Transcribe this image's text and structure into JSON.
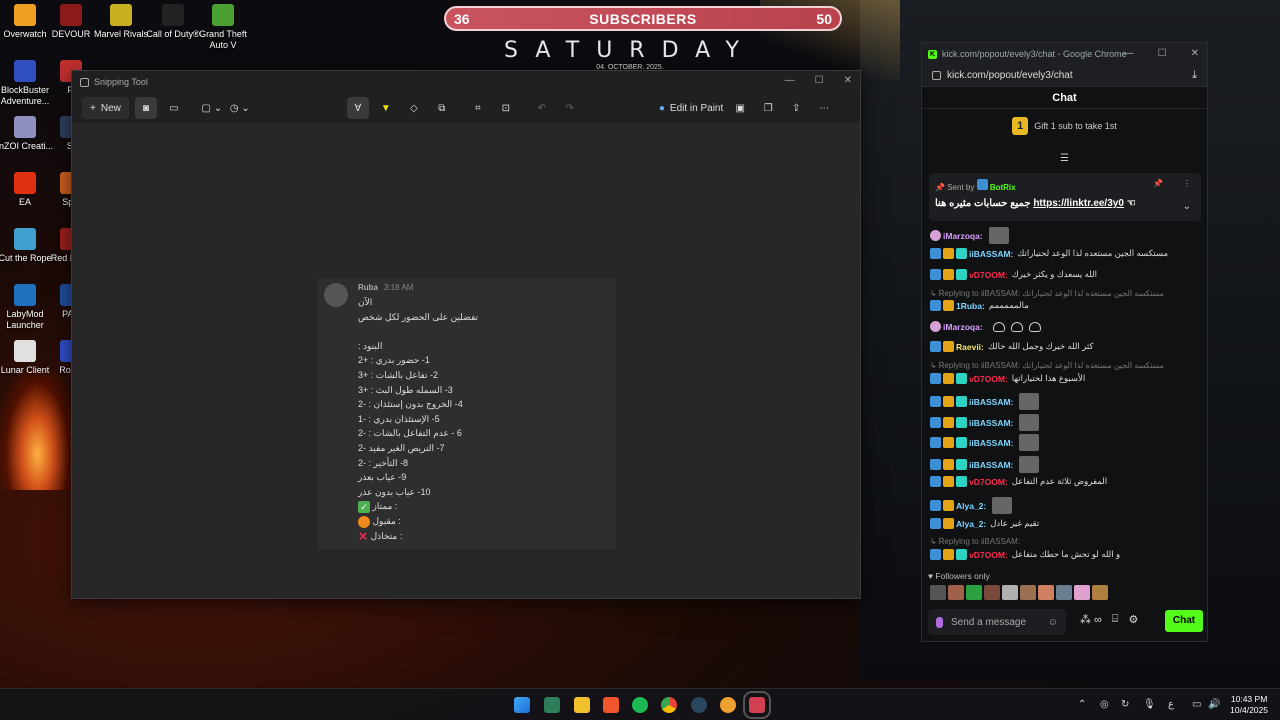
{
  "desktop_icons": [
    {
      "label": "Overwatch",
      "color": "#f0a020"
    },
    {
      "label": "DEVOUR",
      "color": "#8b1a1a"
    },
    {
      "label": "Marvel Rivals",
      "color": "#c8b020"
    },
    {
      "label": "Call of Duty®",
      "color": "#222222"
    },
    {
      "label": "Grand Theft Auto V",
      "color": "#4aa030"
    },
    {
      "label": "BlockBuster Adventure...",
      "color": "#3050c0"
    },
    {
      "label": "inZOI Creati...",
      "color": "#9090c0"
    },
    {
      "label": "EA",
      "color": "#e03010"
    },
    {
      "label": "Cut the Rope",
      "color": "#40a0d0"
    },
    {
      "label": "LabyMod Launcher",
      "color": "#2070c0"
    },
    {
      "label": "Lunar Client",
      "color": "#e0e0e0"
    },
    {
      "label": "Fi",
      "color": "#c03030"
    },
    {
      "label": "St",
      "color": "#304060"
    },
    {
      "label": "Split",
      "color": "#d06020"
    },
    {
      "label": "Red Rede",
      "color": "#a02020"
    },
    {
      "label": "PAN",
      "color": "#2050a0"
    },
    {
      "label": "Roblo",
      "color": "#3050d0"
    }
  ],
  "overlay": {
    "sub_left": "36",
    "sub_title": "SUBSCRIBERS",
    "sub_right": "50",
    "day": "SATURDAY",
    "date": "04. OCTOBER. 2025."
  },
  "snip": {
    "title": "Snipping Tool",
    "new_label": "New",
    "edit_in_paint": "Edit in Paint",
    "msg_user": "Ruba",
    "msg_time": "3:18 AM",
    "msg_lines": [
      "الآن",
      "تفضلين على الحضور لكل شخص",
      "",
      "البنود :",
      "1- حضور بدري : +2",
      "2- تفاعل بالشات : +3",
      "3- السمله طول البث : +3",
      "4- الخروج بدون إستئذان : -2",
      "5- الإستئذان بدري : -1",
      "6 - عدم التفاعل بالشات : -2",
      "7- التريص الغير مفيد -2",
      "8- التأخير : -2",
      "9- عياب بعذر",
      "10- عياب بدون عذر"
    ],
    "legend": [
      {
        "label": ": ممتاز",
        "mark": "✓"
      },
      {
        "label": ": مقبول",
        "mark": "●"
      },
      {
        "label": ": متخاذل",
        "mark": "✕"
      }
    ]
  },
  "chrome": {
    "title": "kick.com/popout/evely3/chat - Google Chrome",
    "url": "kick.com/popout/evely3/chat",
    "chat_header": "Chat",
    "gift_count": "1",
    "gift_text": "Gift 1 sub to take 1st",
    "pinned_sent_by": "Sent by",
    "pinned_user": "BotRix",
    "pinned_text": "جميع حسابات مثيره هنا",
    "pinned_link": "https://linktr.ee/3y0",
    "followers_only": "Followers only",
    "send_placeholder": "Send a message",
    "chat_button": "Chat",
    "messages": [
      {
        "user": "iMarzoqa:",
        "color": "#d8a0ff",
        "badges": "m",
        "text": "",
        "thumb": true
      },
      {
        "user": "iiBASSAM:",
        "color": "#7fd6ff",
        "badges": "123",
        "text": "مستكسه الجين مستعده لذا الوعد لحنياراتك"
      },
      {
        "user": "vD7OOM:",
        "color": "#ff2d4a",
        "badges": "123",
        "text": "الله يسعدك و يكثر خيرك"
      },
      {
        "reply": "Replying to iiBASSAM: مستكسه الجين مستعده لذا الوعد لحنياراتك"
      },
      {
        "user": "1Ruba:",
        "color": "#7fd6ff",
        "badges": "12",
        "text": "مالمممممم"
      },
      {
        "user": "iMarzoqa:",
        "color": "#d8a0ff",
        "badges": "m",
        "text": "",
        "hearts": 3
      },
      {
        "user": "Raevii:",
        "color": "#f2e36a",
        "badges": "12",
        "text": "كثر الله خيرك وجمل الله حالك"
      },
      {
        "reply": "Replying to iiBASSAM: مستكسه الجين مستعده لذا الوعد لحنياراتك"
      },
      {
        "user": "vD7OOM:",
        "color": "#ff2d4a",
        "badges": "123",
        "text": "الأسبوع هذا لحتياراتها"
      },
      {
        "user": "iiBASSAM:",
        "color": "#7fd6ff",
        "badges": "123",
        "text": "",
        "thumb": true
      },
      {
        "user": "iiBASSAM:",
        "color": "#7fd6ff",
        "badges": "123",
        "text": "",
        "thumb": true
      },
      {
        "user": "iiBASSAM:",
        "color": "#7fd6ff",
        "badges": "123",
        "text": "",
        "thumb": true
      },
      {
        "user": "iiBASSAM:",
        "color": "#7fd6ff",
        "badges": "123",
        "text": "",
        "thumb": true
      },
      {
        "user": "vD7OOM:",
        "color": "#ff2d4a",
        "badges": "123",
        "text": "المفروض ثلاثة عدم التفاعل"
      },
      {
        "user": "Alya_2:",
        "color": "#7fd6ff",
        "badges": "12",
        "text": "",
        "thumb": true
      },
      {
        "user": "Alya_2:",
        "color": "#7fd6ff",
        "badges": "12",
        "text": "تقيم غير عادل"
      },
      {
        "reply": "Replying to iiBASSAM:"
      },
      {
        "user": "vD7OOM:",
        "color": "#ff2d4a",
        "badges": "123",
        "text": "و الله لو تحش ما حطك متفاعل"
      }
    ]
  },
  "taskbar": {
    "time": "10:43 PM",
    "date": "10/4/2025",
    "lang": "ع"
  }
}
